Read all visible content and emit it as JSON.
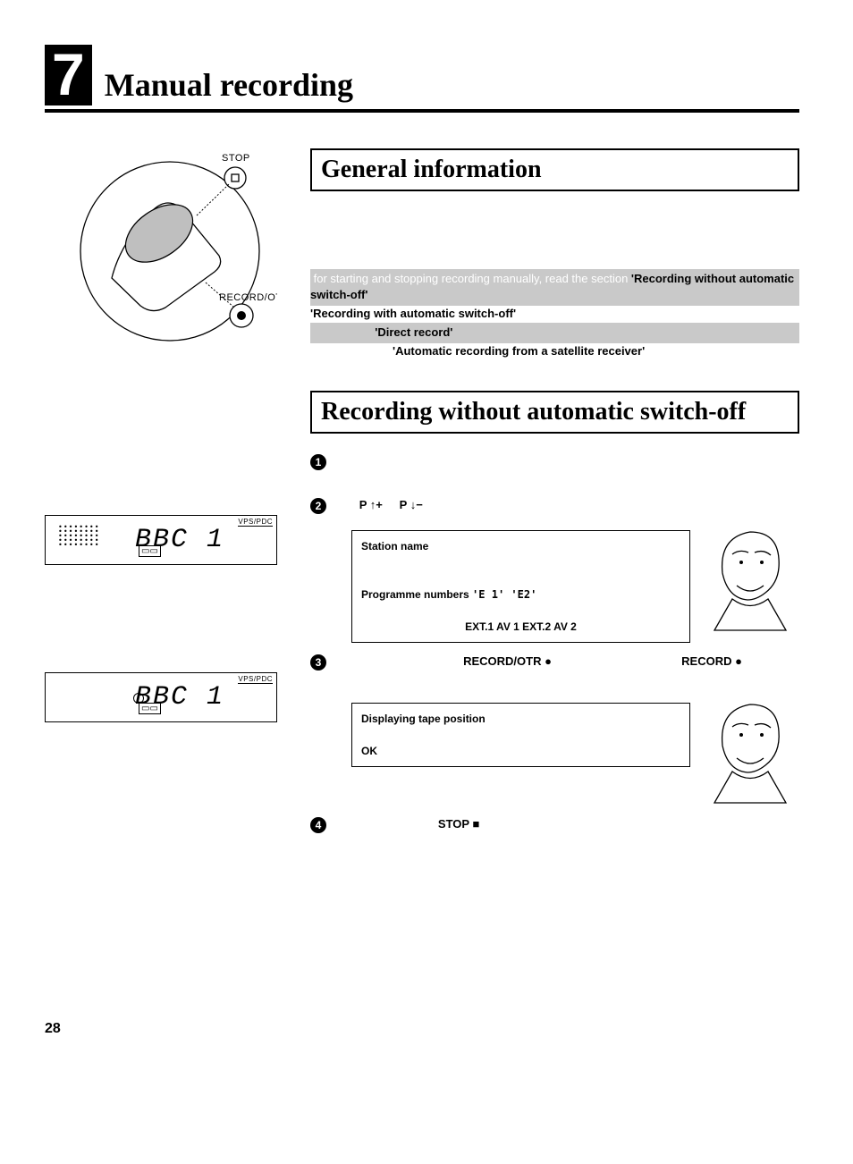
{
  "chapter": {
    "number": "7",
    "title": "Manual recording"
  },
  "remote_labels": {
    "stop": "STOP",
    "record_otr": "RECORD/OTR"
  },
  "section1": {
    "title": "General information",
    "row1_strong": "'Recording without automatic switch-off'",
    "row2_strong": "'Recording with automatic switch-off'",
    "row3_strong": "'Direct record'",
    "row4_strong": "'Automatic recording from a satellite receiver'"
  },
  "section2": {
    "title": "Recording without automatic switch-off",
    "step2": {
      "p_up": "P ↑+",
      "p_down": "P ↓−"
    },
    "hint1": {
      "line1": "Station name",
      "line2a": "Programme numbers",
      "line2b": "'E 1' 'E2'",
      "line3": "EXT.1 AV 1   EXT.2 AV 2"
    },
    "step3": {
      "record_otr": "RECORD/OTR ●",
      "record": "RECORD ●"
    },
    "hint2": {
      "line1": "Displaying tape position",
      "line2": "OK"
    },
    "step4": {
      "stop": "STOP ■"
    }
  },
  "displays": {
    "vpspdc": "VPS/PDC",
    "channel": "BBC 1",
    "tape": "▭"
  },
  "page": "28"
}
